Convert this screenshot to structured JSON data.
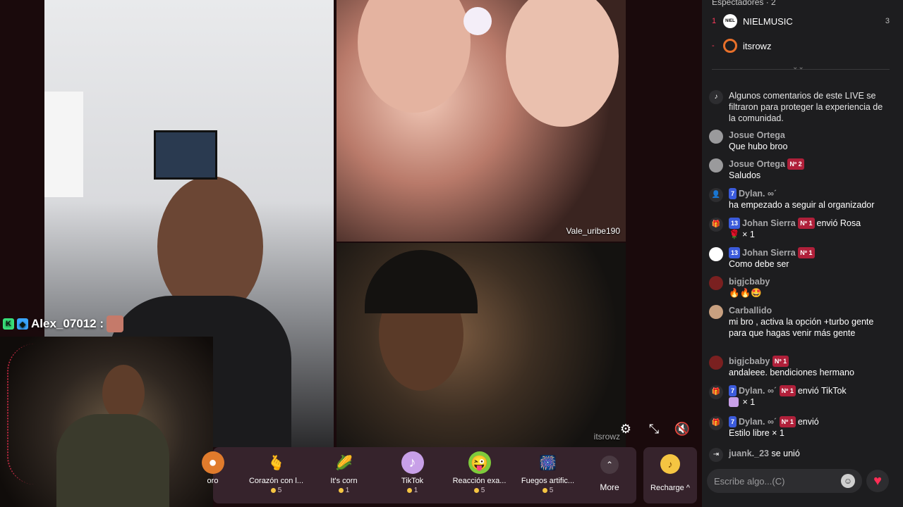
{
  "stage": {
    "overlay_user": "Alex_07012 :",
    "girls_tile_label": "Vale_uribe190",
    "gamer_tile_label": "itsrowz"
  },
  "controls": {
    "settings_icon": "gear-icon",
    "fullscreen_exit_icon": "compress-icon",
    "mute_icon": "speaker-muted-icon"
  },
  "gifts": [
    {
      "name": "oro",
      "price": "",
      "icon": "🍩"
    },
    {
      "name": "Corazón con l...",
      "price": "5",
      "icon": "🫰"
    },
    {
      "name": "It's corn",
      "price": "1",
      "icon": "🌽"
    },
    {
      "name": "TikTok",
      "price": "1",
      "icon": "♪"
    },
    {
      "name": "Reacción exa...",
      "price": "5",
      "icon": "🤪"
    },
    {
      "name": "Fuegos artific...",
      "price": "5",
      "icon": "🎆"
    }
  ],
  "more_label": "More",
  "recharge_label": "Recharge ^",
  "viewers": {
    "header": "Espectadores · 2",
    "list": [
      {
        "rank": "1",
        "name": "NIELMUSIC",
        "count": "3",
        "avatar": "NIEL"
      },
      {
        "rank": "-",
        "name": "itsrowz",
        "count": "",
        "avatar": ""
      }
    ]
  },
  "chat": [
    {
      "type": "system",
      "text": "Algunos comentarios de este LIVE se filtraron para proteger la experiencia de la comunidad."
    },
    {
      "user": "Josue Ortega",
      "badges": "",
      "text": "Que hubo broo"
    },
    {
      "user": "Josue Ortega",
      "fan": "Nº 2",
      "text": "Saludos"
    },
    {
      "user": "Dylan. ∞ˊ",
      "lvl": "7",
      "text": "ha empezado a seguir al organizador"
    },
    {
      "user": "Johan Sierra",
      "lvl": "13",
      "fan": "Nº 1",
      "action": "envió Rosa",
      "text": "× 1"
    },
    {
      "user": "Johan Sierra",
      "lvl": "13",
      "fan": "Nº 1",
      "text": "Como debe ser"
    },
    {
      "user": "bigjcbaby",
      "text": "🔥🔥🤩"
    },
    {
      "user": "Carballido",
      "text": "mi bro , activa la opción +turbo gente para que hagas venir más gente"
    },
    {
      "user": "bigjcbaby",
      "fan": "Nº 1",
      "text": "andaleee. bendiciones hermano"
    },
    {
      "user": "Dylan. ∞ˊ",
      "lvl": "7",
      "fan": "Nº 1",
      "action": "envió TikTok",
      "text": "× 1"
    },
    {
      "user": "Dylan. ∞ˊ",
      "lvl": "7",
      "fan": "Nº 1",
      "action": "envió",
      "text": "Estilo libre × 1"
    },
    {
      "user": "juank._23",
      "action": "se unió",
      "text": ""
    }
  ],
  "input": {
    "placeholder": "Escribe algo...(C)"
  }
}
